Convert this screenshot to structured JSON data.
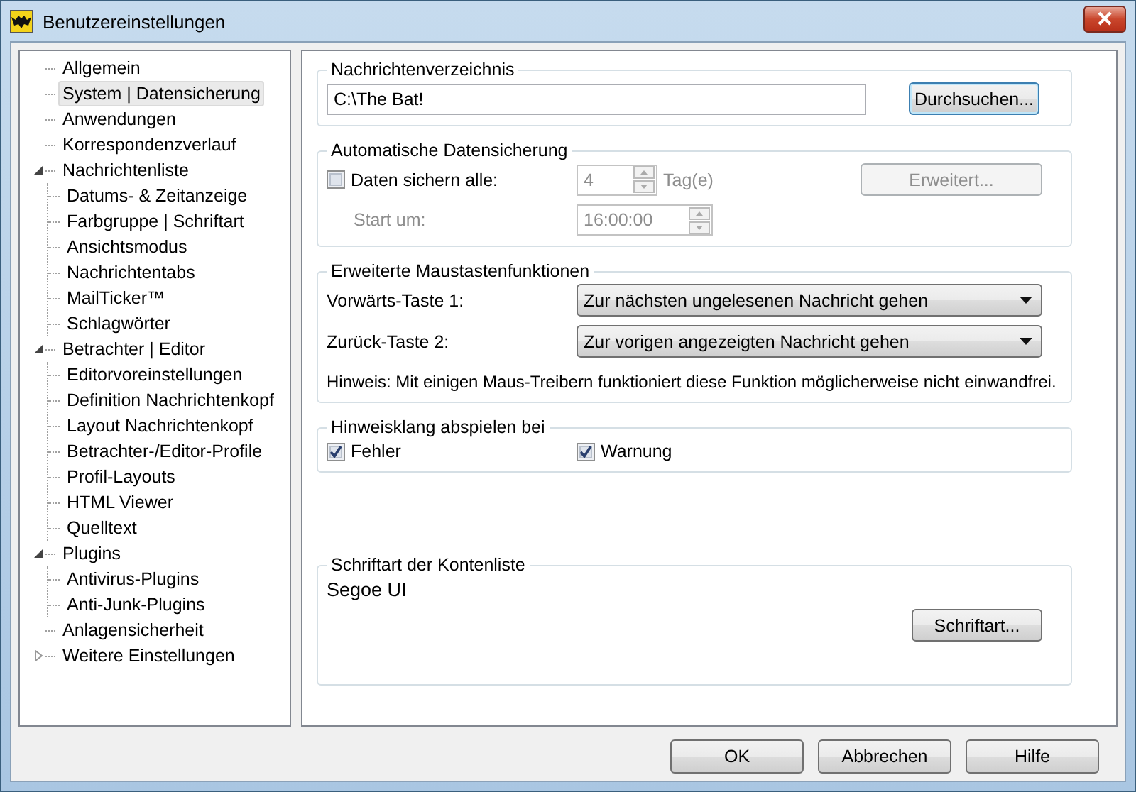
{
  "window": {
    "title": "Benutzereinstellungen"
  },
  "tree": [
    {
      "label": "Allgemein",
      "selected": false
    },
    {
      "label": "System | Datensicherung",
      "selected": true
    },
    {
      "label": "Anwendungen",
      "selected": false
    },
    {
      "label": "Korrespondenzverlauf",
      "selected": false
    },
    {
      "label": "Nachrichtenliste",
      "selected": false,
      "expanded": true,
      "children": [
        {
          "label": "Datums- & Zeitanzeige",
          "selected": false
        },
        {
          "label": "Farbgruppe | Schriftart",
          "selected": false
        },
        {
          "label": "Ansichtsmodus",
          "selected": false
        },
        {
          "label": "Nachrichtentabs",
          "selected": false
        },
        {
          "label": "MailTicker™",
          "selected": false
        },
        {
          "label": "Schlagwörter",
          "selected": false
        }
      ]
    },
    {
      "label": "Betrachter | Editor",
      "selected": false,
      "expanded": true,
      "children": [
        {
          "label": "Editorvoreinstellungen",
          "selected": false
        },
        {
          "label": "Definition Nachrichtenkopf",
          "selected": false
        },
        {
          "label": "Layout Nachrichtenkopf",
          "selected": false
        },
        {
          "label": "Betrachter-/Editor-Profile",
          "selected": false
        },
        {
          "label": "Profil-Layouts",
          "selected": false
        },
        {
          "label": "HTML Viewer",
          "selected": false
        },
        {
          "label": "Quelltext",
          "selected": false
        }
      ]
    },
    {
      "label": "Plugins",
      "selected": false,
      "expanded": true,
      "children": [
        {
          "label": "Antivirus-Plugins",
          "selected": false
        },
        {
          "label": "Anti-Junk-Plugins",
          "selected": false
        }
      ]
    },
    {
      "label": "Anlagensicherheit",
      "selected": false
    },
    {
      "label": "Weitere Einstellungen",
      "selected": false,
      "expanded": false
    }
  ],
  "message_folder": {
    "legend": "Nachrichtenverzeichnis",
    "path": "C:\\The Bat!",
    "browse_button": "Durchsuchen..."
  },
  "auto_backup": {
    "legend": "Automatische Datensicherung",
    "checkbox": {
      "label": "Daten sichern alle:",
      "checked": false
    },
    "disabled": true,
    "interval": "4",
    "unit": "Tag(e)",
    "start_label": "Start um:",
    "start_time": "16:00:00",
    "advanced_button": "Erweitert..."
  },
  "mouse_buttons": {
    "legend": "Erweiterte Maustastenfunktionen",
    "rows": [
      {
        "label": "Vorwärts-Taste 1:",
        "value": "Zur nächsten ungelesenen Nachricht gehen"
      },
      {
        "label": "Zurück-Taste 2:",
        "value": "Zur vorigen angezeigten Nachricht gehen"
      }
    ],
    "note": "Hinweis: Mit einigen Maus-Treibern funktioniert diese Funktion möglicherweise nicht einwandfrei."
  },
  "sound": {
    "legend": "Hinweisklang abspielen bei",
    "options": [
      {
        "label": "Fehler",
        "checked": true
      },
      {
        "label": "Warnung",
        "checked": true
      }
    ]
  },
  "account_font": {
    "legend": "Schriftart der Kontenliste",
    "font_name": "Segoe UI",
    "button": "Schriftart..."
  },
  "buttons": [
    "OK",
    "Abbrechen",
    "Hilfe"
  ]
}
